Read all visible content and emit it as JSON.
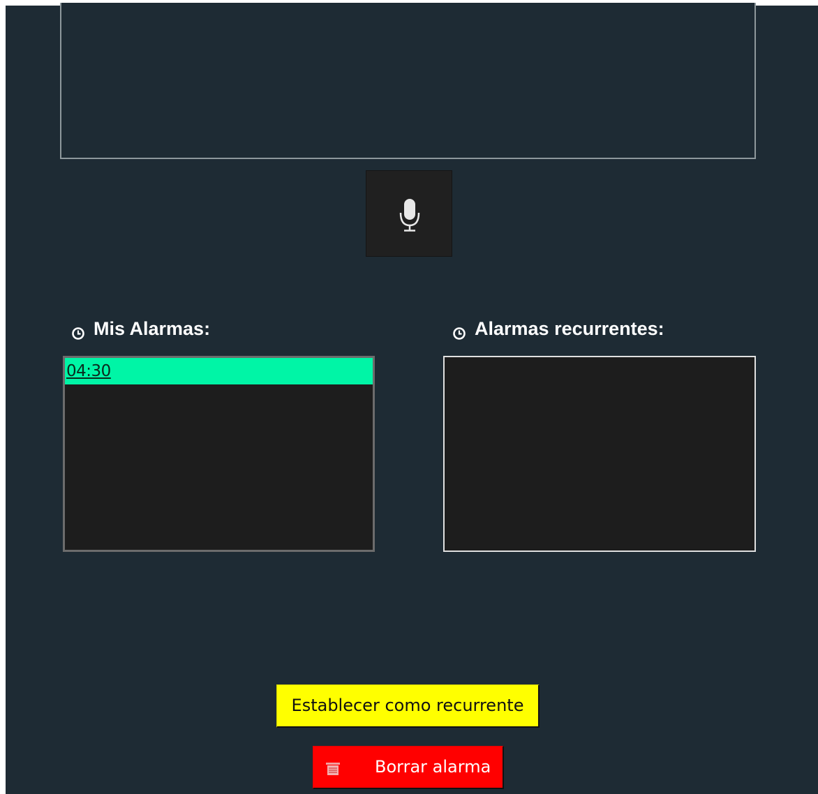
{
  "transcript": {
    "value": ""
  },
  "mic": {
    "icon": "microphone-icon"
  },
  "alarms": {
    "title": "Mis Alarmas:",
    "icon": "clock-icon",
    "items": [
      {
        "label": "04:30 ",
        "selected": true
      }
    ]
  },
  "recurring": {
    "title": "Alarmas recurrentes:",
    "icon": "clock-icon",
    "items": []
  },
  "buttons": {
    "set_recurrent_label": "Establecer como recurrente",
    "delete_label": "Borrar alarma",
    "delete_icon": "trash-icon"
  },
  "colors": {
    "background": "#1e2b34",
    "list_background": "#1d1d1d",
    "selection": "#00f5a6",
    "recurrent_button": "#ffff00",
    "delete_button": "#ff0000"
  }
}
